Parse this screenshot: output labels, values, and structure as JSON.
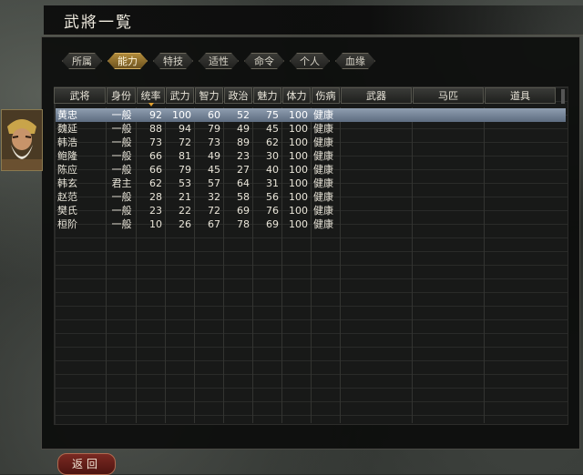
{
  "window": {
    "title": "武將一覧"
  },
  "tabs": [
    {
      "label": "所属",
      "active": false
    },
    {
      "label": "能力",
      "active": true
    },
    {
      "label": "特技",
      "active": false
    },
    {
      "label": "适性",
      "active": false
    },
    {
      "label": "命令",
      "active": false
    },
    {
      "label": "个人",
      "active": false
    },
    {
      "label": "血缘",
      "active": false
    }
  ],
  "table": {
    "columns": [
      "武将",
      "身份",
      "统率",
      "武力",
      "智力",
      "政治",
      "魅力",
      "体力",
      "伤病",
      "武器",
      "马匹",
      "道具"
    ],
    "sorted_column": "统率",
    "rows": [
      [
        "黄忠",
        "一般",
        "92",
        "100",
        "60",
        "52",
        "75",
        "100",
        "健康"
      ],
      [
        "魏延",
        "一般",
        "88",
        "94",
        "79",
        "49",
        "45",
        "100",
        "健康"
      ],
      [
        "韩浩",
        "一般",
        "73",
        "72",
        "73",
        "89",
        "62",
        "100",
        "健康"
      ],
      [
        "鲍隆",
        "一般",
        "66",
        "81",
        "49",
        "23",
        "30",
        "100",
        "健康"
      ],
      [
        "陈应",
        "一般",
        "66",
        "79",
        "45",
        "27",
        "40",
        "100",
        "健康"
      ],
      [
        "韩玄",
        "君主",
        "62",
        "53",
        "57",
        "64",
        "31",
        "100",
        "健康"
      ],
      [
        "赵范",
        "一般",
        "28",
        "21",
        "32",
        "58",
        "56",
        "100",
        "健康"
      ],
      [
        "樊氏",
        "一般",
        "23",
        "22",
        "72",
        "69",
        "76",
        "100",
        "健康"
      ],
      [
        "桓阶",
        "一般",
        "10",
        "26",
        "67",
        "78",
        "69",
        "100",
        "健康"
      ]
    ],
    "selected_row": 0
  },
  "footer": {
    "back_label": "返回"
  },
  "icons": {
    "portrait": "general-portrait-icon"
  },
  "colors": {
    "selected_row": "#7d8ca0",
    "active_tab": "#a07f35",
    "back_button": "#6a221c"
  }
}
